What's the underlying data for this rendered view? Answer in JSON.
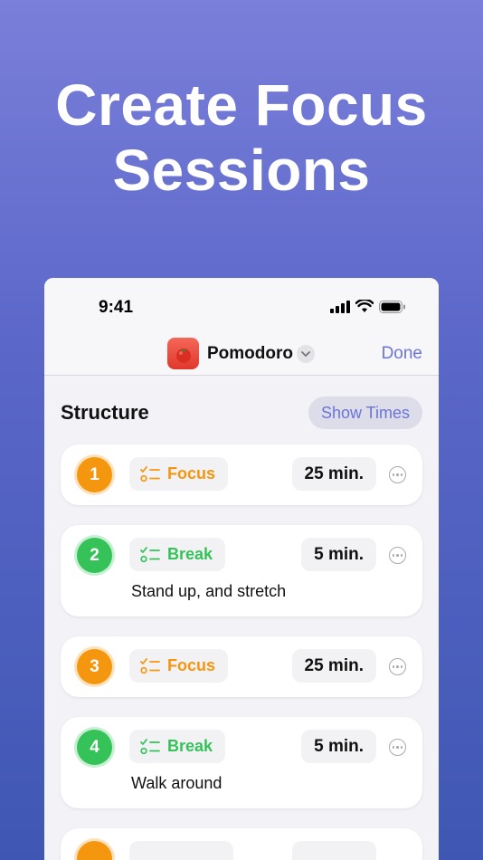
{
  "headline": {
    "line1": "Create Focus",
    "line2": "Sessions"
  },
  "status_bar": {
    "time": "9:41"
  },
  "nav": {
    "title": "Pomodoro",
    "done_label": "Done"
  },
  "section": {
    "title": "Structure",
    "show_times_label": "Show Times"
  },
  "sessions": [
    {
      "number": "1",
      "type": "Focus",
      "duration": "25 min.",
      "note": ""
    },
    {
      "number": "2",
      "type": "Break",
      "duration": "5 min.",
      "note": "Stand up, and stretch"
    },
    {
      "number": "3",
      "type": "Focus",
      "duration": "25 min.",
      "note": ""
    },
    {
      "number": "4",
      "type": "Break",
      "duration": "5 min.",
      "note": "Walk around"
    }
  ],
  "colors": {
    "focus": "#f5960f",
    "break": "#34c259",
    "accent": "#6b74d6"
  }
}
